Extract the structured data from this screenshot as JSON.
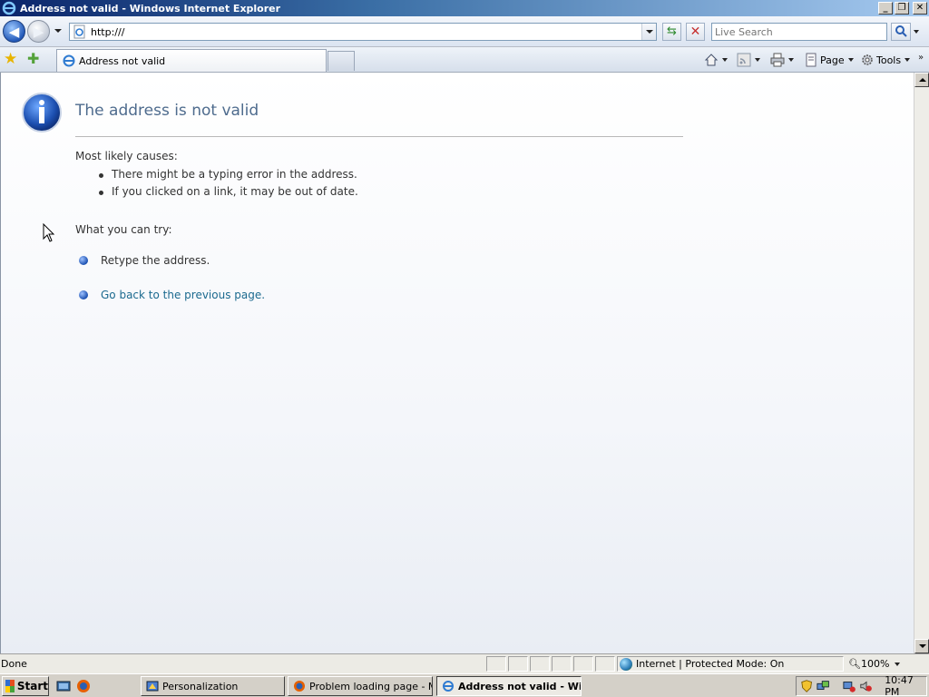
{
  "window": {
    "title": "Address not valid - Windows Internet Explorer",
    "minimize_label": "_",
    "maximize_label": "❐",
    "close_label": "✕"
  },
  "navbar": {
    "address_value": "http:///",
    "search_placeholder": "Live Search"
  },
  "tabs": [
    {
      "label": "Address not valid"
    }
  ],
  "commands": {
    "page_label": "Page",
    "tools_label": "Tools"
  },
  "error_page": {
    "title": "The address is not valid",
    "causes_heading": "Most likely causes:",
    "causes": [
      "There might be a typing error in the address.",
      "If you clicked on a link, it may be out of date."
    ],
    "try_heading": "What you can try:",
    "try_items": [
      "Retype the address.",
      "Go back to the previous page."
    ]
  },
  "statusbar": {
    "status_text": "Done",
    "zone_text": "Internet | Protected Mode: On",
    "zoom_text": "100%"
  },
  "taskbar": {
    "start_label": "Start",
    "tasks": [
      "Personalization",
      "Problem loading page - M...",
      "Address not valid - Wi..."
    ],
    "clock": "10:47 PM"
  },
  "colors": {
    "title_text": "#4e6b8d",
    "link": "#1b6a8f",
    "titlebar_start": "#0a246a"
  }
}
